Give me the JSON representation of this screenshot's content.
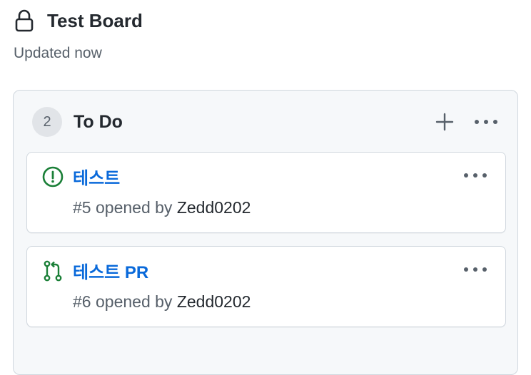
{
  "board": {
    "title": "Test Board",
    "status": "Updated now",
    "icon": "lock-icon"
  },
  "column": {
    "count": "2",
    "title": "To Do",
    "add_icon": "plus-icon",
    "more_icon": "kebab-icon"
  },
  "cards": [
    {
      "type": "issue",
      "icon": "issue-opened-icon",
      "title": "테스트",
      "number": "#5",
      "opened_by": "opened by",
      "author": "Zedd0202",
      "more_icon": "kebab-icon"
    },
    {
      "type": "pull-request",
      "icon": "pull-request-icon",
      "title": "테스트 PR",
      "number": "#6",
      "opened_by": "opened by",
      "author": "Zedd0202",
      "more_icon": "kebab-icon"
    }
  ],
  "colors": {
    "link": "#0969da",
    "open_green": "#1a7f37",
    "muted": "#57606a",
    "text": "#24292f"
  }
}
